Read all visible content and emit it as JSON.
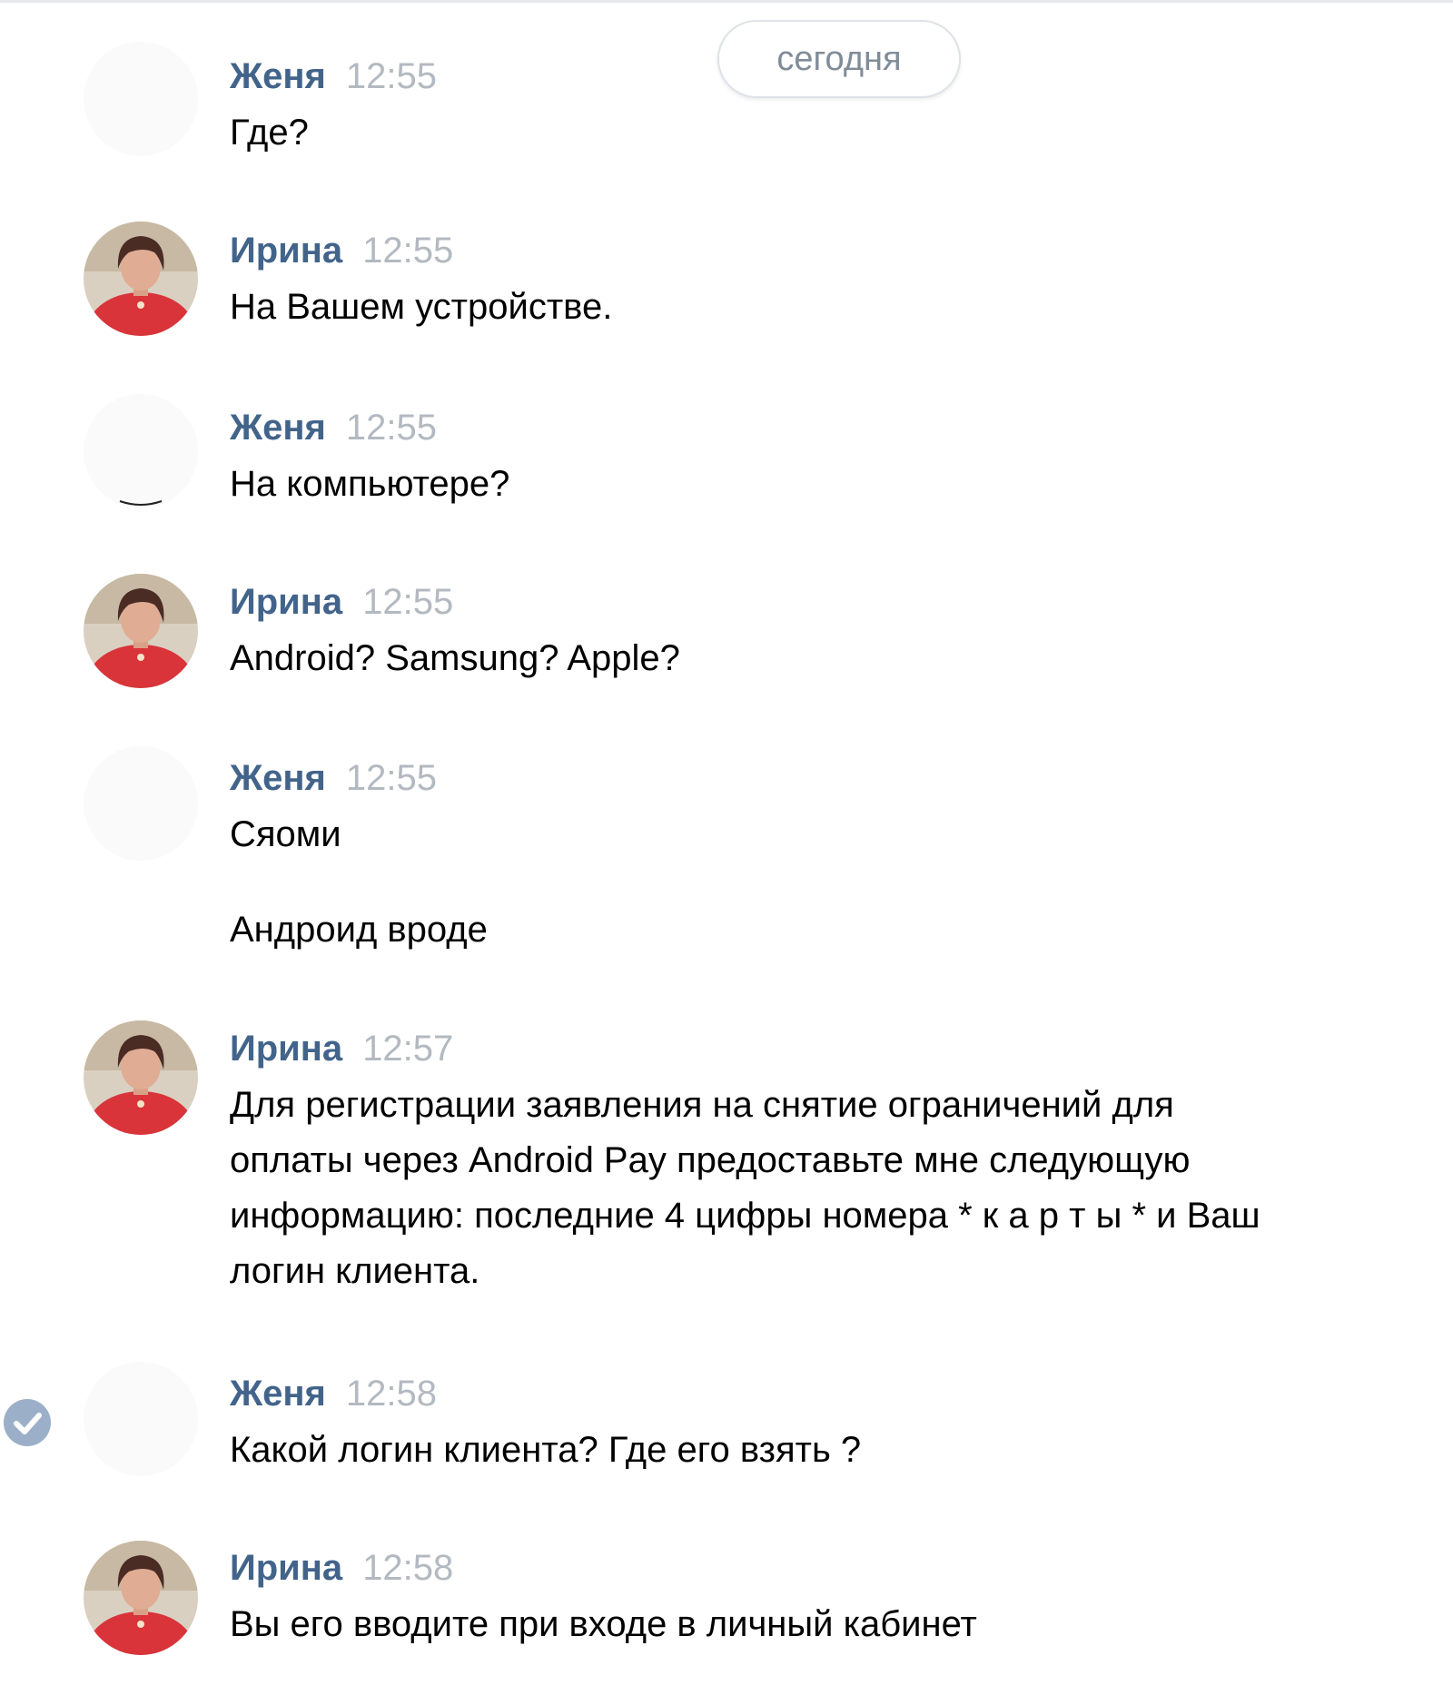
{
  "chat": {
    "date_label": "сегодня",
    "messages": [
      {
        "author": "Женя",
        "time": "12:55",
        "lines": [
          "Где?"
        ]
      },
      {
        "author": "Ирина",
        "time": "12:55",
        "lines": [
          "На Вашем устройстве."
        ]
      },
      {
        "author": "Женя",
        "time": "12:55",
        "lines": [
          "На компьютере?"
        ]
      },
      {
        "author": "Ирина",
        "time": "12:55",
        "lines": [
          "Android? Samsung? Apple?"
        ]
      },
      {
        "author": "Женя",
        "time": "12:55",
        "lines": [
          "Сяоми",
          "Андроид вроде"
        ]
      },
      {
        "author": "Ирина",
        "time": "12:57",
        "lines": [
          "Для регистрации заявления на снятие ограничений для",
          "оплаты через Android Pay предоставьте мне следующую",
          "информацию: последние 4 цифры номера * к а р т ы * и Ваш",
          "логин клиента."
        ]
      },
      {
        "author": "Женя",
        "time": "12:58",
        "lines": [
          "Какой логин клиента? Где его взять ?"
        ]
      },
      {
        "author": "Ирина",
        "time": "12:58",
        "lines": [
          "Вы его вводите при входе в личный кабинет"
        ]
      }
    ]
  },
  "icons": {
    "read_status": "check-circle-icon",
    "avatar_irina": "user-photo-avatar",
    "avatar_zhenya": "blank-avatar"
  },
  "colors": {
    "author": "#42648b",
    "time": "#b3b9c0",
    "text": "#000000",
    "date_pill_text": "#818c99",
    "check": "#9bb0c8"
  }
}
